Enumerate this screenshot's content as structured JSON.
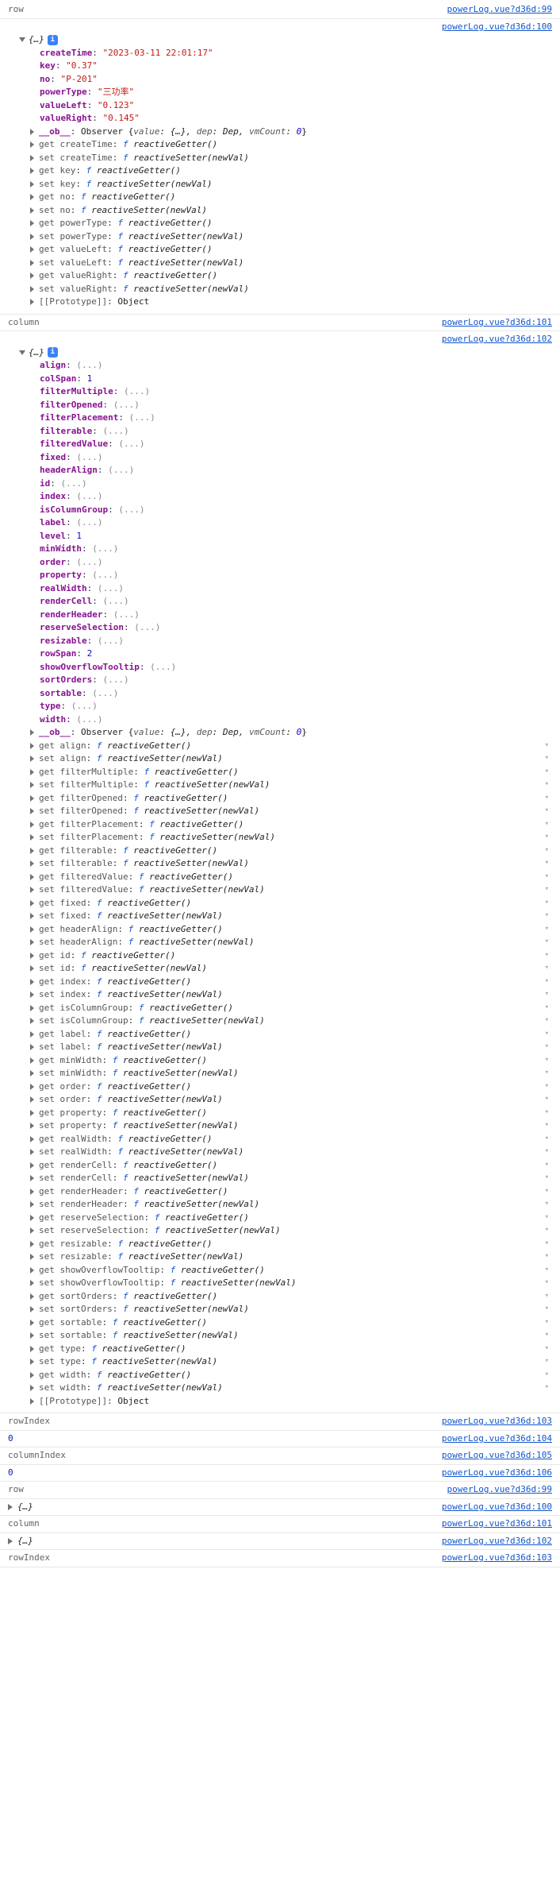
{
  "sections": [
    {
      "type": "header",
      "label": "row",
      "link": "powerLog.vue?d36d:99"
    },
    {
      "type": "object_row",
      "link": "powerLog.vue?d36d:100",
      "own_props": [
        {
          "k": "createTime",
          "v": "\"2023-03-11 22:01:17\"",
          "t": "str"
        },
        {
          "k": "key",
          "v": "\"0.37\"",
          "t": "str"
        },
        {
          "k": "no",
          "v": "\"P-201\"",
          "t": "str"
        },
        {
          "k": "powerType",
          "v": "\"三功率\"",
          "t": "str"
        },
        {
          "k": "valueLeft",
          "v": "\"0.123\"",
          "t": "str"
        },
        {
          "k": "valueRight",
          "v": "\"0.145\"",
          "t": "str"
        }
      ],
      "observer": "Observer {value: {…}, dep: Dep, vmCount: 0}",
      "accessors": [
        {
          "a": "get",
          "n": "createTime",
          "fn": "reactiveGetter()"
        },
        {
          "a": "set",
          "n": "createTime",
          "fn": "reactiveSetter(newVal)"
        },
        {
          "a": "get",
          "n": "key",
          "fn": "reactiveGetter()"
        },
        {
          "a": "set",
          "n": "key",
          "fn": "reactiveSetter(newVal)"
        },
        {
          "a": "get",
          "n": "no",
          "fn": "reactiveGetter()"
        },
        {
          "a": "set",
          "n": "no",
          "fn": "reactiveSetter(newVal)"
        },
        {
          "a": "get",
          "n": "powerType",
          "fn": "reactiveGetter()"
        },
        {
          "a": "set",
          "n": "powerType",
          "fn": "reactiveSetter(newVal)"
        },
        {
          "a": "get",
          "n": "valueLeft",
          "fn": "reactiveGetter()"
        },
        {
          "a": "set",
          "n": "valueLeft",
          "fn": "reactiveSetter(newVal)"
        },
        {
          "a": "get",
          "n": "valueRight",
          "fn": "reactiveGetter()"
        },
        {
          "a": "set",
          "n": "valueRight",
          "fn": "reactiveSetter(newVal)"
        }
      ],
      "proto": "[[Prototype]]: Object"
    },
    {
      "type": "header",
      "label": "column",
      "link": "powerLog.vue?d36d:101"
    },
    {
      "type": "object_col",
      "link": "powerLog.vue?d36d:102",
      "own_props": [
        {
          "k": "align",
          "v": "(...)",
          "t": "ell"
        },
        {
          "k": "colSpan",
          "v": "1",
          "t": "num"
        },
        {
          "k": "filterMultiple",
          "v": "(...)",
          "t": "ell"
        },
        {
          "k": "filterOpened",
          "v": "(...)",
          "t": "ell"
        },
        {
          "k": "filterPlacement",
          "v": "(...)",
          "t": "ell"
        },
        {
          "k": "filterable",
          "v": "(...)",
          "t": "ell"
        },
        {
          "k": "filteredValue",
          "v": "(...)",
          "t": "ell"
        },
        {
          "k": "fixed",
          "v": "(...)",
          "t": "ell"
        },
        {
          "k": "headerAlign",
          "v": "(...)",
          "t": "ell"
        },
        {
          "k": "id",
          "v": "(...)",
          "t": "ell"
        },
        {
          "k": "index",
          "v": "(...)",
          "t": "ell"
        },
        {
          "k": "isColumnGroup",
          "v": "(...)",
          "t": "ell"
        },
        {
          "k": "label",
          "v": "(...)",
          "t": "ell"
        },
        {
          "k": "level",
          "v": "1",
          "t": "num"
        },
        {
          "k": "minWidth",
          "v": "(...)",
          "t": "ell"
        },
        {
          "k": "order",
          "v": "(...)",
          "t": "ell"
        },
        {
          "k": "property",
          "v": "(...)",
          "t": "ell"
        },
        {
          "k": "realWidth",
          "v": "(...)",
          "t": "ell"
        },
        {
          "k": "renderCell",
          "v": "(...)",
          "t": "ell"
        },
        {
          "k": "renderHeader",
          "v": "(...)",
          "t": "ell"
        },
        {
          "k": "reserveSelection",
          "v": "(...)",
          "t": "ell"
        },
        {
          "k": "resizable",
          "v": "(...)",
          "t": "ell"
        },
        {
          "k": "rowSpan",
          "v": "2",
          "t": "num"
        },
        {
          "k": "showOverflowTooltip",
          "v": "(...)",
          "t": "ell"
        },
        {
          "k": "sortOrders",
          "v": "(...)",
          "t": "ell"
        },
        {
          "k": "sortable",
          "v": "(...)",
          "t": "ell"
        },
        {
          "k": "type",
          "v": "(...)",
          "t": "ell"
        },
        {
          "k": "width",
          "v": "(...)",
          "t": "ell"
        }
      ],
      "observer": "Observer {value: {…}, dep: Dep, vmCount: 0}",
      "accessors": [
        {
          "a": "get",
          "n": "align",
          "fn": "reactiveGetter()",
          "arrow": true
        },
        {
          "a": "set",
          "n": "align",
          "fn": "reactiveSetter(newVal)",
          "arrow": true
        },
        {
          "a": "get",
          "n": "filterMultiple",
          "fn": "reactiveGetter()",
          "arrow": true
        },
        {
          "a": "set",
          "n": "filterMultiple",
          "fn": "reactiveSetter(newVal)",
          "arrow": true
        },
        {
          "a": "get",
          "n": "filterOpened",
          "fn": "reactiveGetter()",
          "arrow": true
        },
        {
          "a": "set",
          "n": "filterOpened",
          "fn": "reactiveSetter(newVal)",
          "arrow": true
        },
        {
          "a": "get",
          "n": "filterPlacement",
          "fn": "reactiveGetter()",
          "arrow": true
        },
        {
          "a": "set",
          "n": "filterPlacement",
          "fn": "reactiveSetter(newVal)",
          "arrow": true
        },
        {
          "a": "get",
          "n": "filterable",
          "fn": "reactiveGetter()",
          "arrow": true
        },
        {
          "a": "set",
          "n": "filterable",
          "fn": "reactiveSetter(newVal)",
          "arrow": true
        },
        {
          "a": "get",
          "n": "filteredValue",
          "fn": "reactiveGetter()",
          "arrow": true
        },
        {
          "a": "set",
          "n": "filteredValue",
          "fn": "reactiveSetter(newVal)",
          "arrow": true
        },
        {
          "a": "get",
          "n": "fixed",
          "fn": "reactiveGetter()",
          "arrow": true
        },
        {
          "a": "set",
          "n": "fixed",
          "fn": "reactiveSetter(newVal)",
          "arrow": true
        },
        {
          "a": "get",
          "n": "headerAlign",
          "fn": "reactiveGetter()",
          "arrow": true
        },
        {
          "a": "set",
          "n": "headerAlign",
          "fn": "reactiveSetter(newVal)",
          "arrow": true
        },
        {
          "a": "get",
          "n": "id",
          "fn": "reactiveGetter()",
          "arrow": true
        },
        {
          "a": "set",
          "n": "id",
          "fn": "reactiveSetter(newVal)",
          "arrow": true
        },
        {
          "a": "get",
          "n": "index",
          "fn": "reactiveGetter()",
          "arrow": true
        },
        {
          "a": "set",
          "n": "index",
          "fn": "reactiveSetter(newVal)",
          "arrow": true
        },
        {
          "a": "get",
          "n": "isColumnGroup",
          "fn": "reactiveGetter()",
          "arrow": true
        },
        {
          "a": "set",
          "n": "isColumnGroup",
          "fn": "reactiveSetter(newVal)",
          "arrow": true
        },
        {
          "a": "get",
          "n": "label",
          "fn": "reactiveGetter()",
          "arrow": true
        },
        {
          "a": "set",
          "n": "label",
          "fn": "reactiveSetter(newVal)",
          "arrow": true
        },
        {
          "a": "get",
          "n": "minWidth",
          "fn": "reactiveGetter()",
          "arrow": true
        },
        {
          "a": "set",
          "n": "minWidth",
          "fn": "reactiveSetter(newVal)",
          "arrow": true
        },
        {
          "a": "get",
          "n": "order",
          "fn": "reactiveGetter()",
          "arrow": true
        },
        {
          "a": "set",
          "n": "order",
          "fn": "reactiveSetter(newVal)",
          "arrow": true
        },
        {
          "a": "get",
          "n": "property",
          "fn": "reactiveGetter()",
          "arrow": true
        },
        {
          "a": "set",
          "n": "property",
          "fn": "reactiveSetter(newVal)",
          "arrow": true
        },
        {
          "a": "get",
          "n": "realWidth",
          "fn": "reactiveGetter()",
          "arrow": true
        },
        {
          "a": "set",
          "n": "realWidth",
          "fn": "reactiveSetter(newVal)",
          "arrow": true
        },
        {
          "a": "get",
          "n": "renderCell",
          "fn": "reactiveGetter()",
          "arrow": true
        },
        {
          "a": "set",
          "n": "renderCell",
          "fn": "reactiveSetter(newVal)",
          "arrow": true
        },
        {
          "a": "get",
          "n": "renderHeader",
          "fn": "reactiveGetter()",
          "arrow": true
        },
        {
          "a": "set",
          "n": "renderHeader",
          "fn": "reactiveSetter(newVal)",
          "arrow": true
        },
        {
          "a": "get",
          "n": "reserveSelection",
          "fn": "reactiveGetter()",
          "arrow": true
        },
        {
          "a": "set",
          "n": "reserveSelection",
          "fn": "reactiveSetter(newVal)",
          "arrow": true
        },
        {
          "a": "get",
          "n": "resizable",
          "fn": "reactiveGetter()",
          "arrow": true
        },
        {
          "a": "set",
          "n": "resizable",
          "fn": "reactiveSetter(newVal)",
          "arrow": true
        },
        {
          "a": "get",
          "n": "showOverflowTooltip",
          "fn": "reactiveGetter()",
          "arrow": true
        },
        {
          "a": "set",
          "n": "showOverflowTooltip",
          "fn": "reactiveSetter(newVal)",
          "arrow": true
        },
        {
          "a": "get",
          "n": "sortOrders",
          "fn": "reactiveGetter()",
          "arrow": true
        },
        {
          "a": "set",
          "n": "sortOrders",
          "fn": "reactiveSetter(newVal)",
          "arrow": true
        },
        {
          "a": "get",
          "n": "sortable",
          "fn": "reactiveGetter()",
          "arrow": true
        },
        {
          "a": "set",
          "n": "sortable",
          "fn": "reactiveSetter(newVal)",
          "arrow": true
        },
        {
          "a": "get",
          "n": "type",
          "fn": "reactiveGetter()",
          "arrow": true
        },
        {
          "a": "set",
          "n": "type",
          "fn": "reactiveSetter(newVal)",
          "arrow": true
        },
        {
          "a": "get",
          "n": "width",
          "fn": "reactiveGetter()",
          "arrow": true
        },
        {
          "a": "set",
          "n": "width",
          "fn": "reactiveSetter(newVal)",
          "arrow": true
        }
      ],
      "proto": "[[Prototype]]: Object"
    },
    {
      "type": "header",
      "label": "rowIndex",
      "link": "powerLog.vue?d36d:103"
    },
    {
      "type": "value",
      "val": "0",
      "vtype": "num",
      "link": "powerLog.vue?d36d:104"
    },
    {
      "type": "header",
      "label": "columnIndex",
      "link": "powerLog.vue?d36d:105"
    },
    {
      "type": "value",
      "val": "0",
      "vtype": "num",
      "link": "powerLog.vue?d36d:106"
    },
    {
      "type": "header",
      "label": "row",
      "link": "powerLog.vue?d36d:99"
    },
    {
      "type": "collapsed_obj",
      "link": "powerLog.vue?d36d:100"
    },
    {
      "type": "header",
      "label": "column",
      "link": "powerLog.vue?d36d:101"
    },
    {
      "type": "collapsed_obj",
      "link": "powerLog.vue?d36d:102"
    },
    {
      "type": "header",
      "label": "rowIndex",
      "link": "powerLog.vue?d36d:103"
    }
  ],
  "braces_collapsed": "{…}",
  "ob_key": "__ob__",
  "observer_label": "Observer",
  "value_label": "value",
  "dep_label": "dep",
  "dep_val": "Dep",
  "vmcount_label": "vmCount",
  "f_text": "f",
  "info_char": "i"
}
